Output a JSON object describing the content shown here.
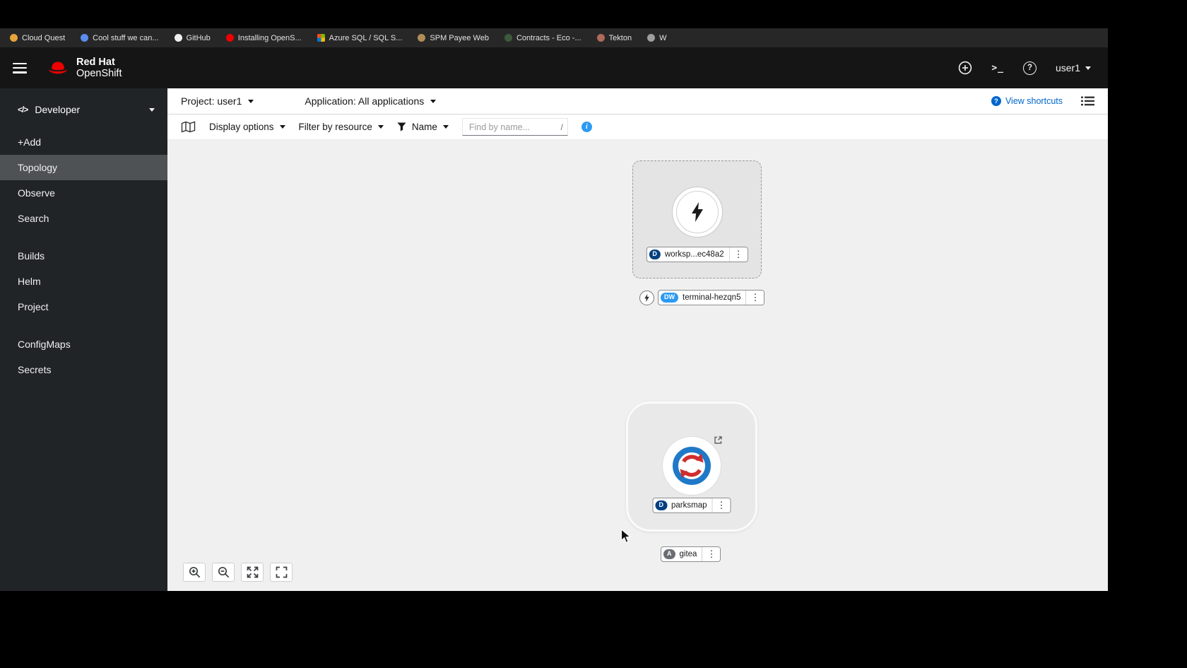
{
  "bookmarks": {
    "items": [
      {
        "label": "Cloud Quest",
        "color": "#e8a33d"
      },
      {
        "label": "Cool stuff we can...",
        "color": "#5b8def"
      },
      {
        "label": "GitHub",
        "color": "#f0f0f0"
      },
      {
        "label": "Installing OpenS...",
        "color": "#ee0000"
      },
      {
        "label": "Azure SQL / SQL S...",
        "color": "#0078d4"
      },
      {
        "label": "SPM Payee Web",
        "color": "#b08d57"
      },
      {
        "label": "Contracts - Eco -...",
        "color": "#3d5a3d"
      },
      {
        "label": "Tekton",
        "color": "#b0695a"
      },
      {
        "label": "W",
        "color": "#9e9e9e"
      }
    ]
  },
  "masthead": {
    "brand_top": "Red Hat",
    "brand_bottom": "OpenShift",
    "username": "user1"
  },
  "sidebar": {
    "perspective": "Developer",
    "groups": [
      {
        "items": [
          {
            "label": "+Add"
          },
          {
            "label": "Topology"
          },
          {
            "label": "Observe"
          },
          {
            "label": "Search"
          }
        ]
      },
      {
        "items": [
          {
            "label": "Builds"
          },
          {
            "label": "Helm"
          },
          {
            "label": "Project"
          }
        ]
      },
      {
        "items": [
          {
            "label": "ConfigMaps"
          },
          {
            "label": "Secrets"
          }
        ]
      }
    ],
    "active_item": "Topology"
  },
  "context_bar": {
    "project": "Project: user1",
    "application": "Application: All applications",
    "view_shortcuts": "View shortcuts"
  },
  "toolbar": {
    "display_options": "Display options",
    "filter_by_resource": "Filter by resource",
    "name_filter": "Name",
    "find_placeholder": "Find by name...",
    "find_shortcut": "/"
  },
  "topology": {
    "workspace": {
      "badge": "D",
      "label": "worksp...ec48a2"
    },
    "terminal": {
      "badge": "DW",
      "label": "terminal-hezqn5"
    },
    "parksmap": {
      "badge": "D",
      "label": "parksmap"
    },
    "gitea": {
      "badge": "A",
      "label": "gitea"
    }
  },
  "icons": {
    "developer_glyph": "</>",
    "terminal_glyph": ">_",
    "kebab_glyph": "⋮",
    "help_glyph": "?",
    "info_glyph": "i"
  },
  "colors": {
    "deployment_badge": "#004080",
    "devworkspace_badge": "#2b9af3",
    "application_badge": "#6a6e73",
    "accent_blue": "#0066cc",
    "info_blue": "#2b9af3",
    "brand_red": "#ee0000",
    "sidebar_bg": "#212427",
    "sidebar_active_bg": "#4f5255",
    "canvas_bg": "#f0f0f0"
  }
}
